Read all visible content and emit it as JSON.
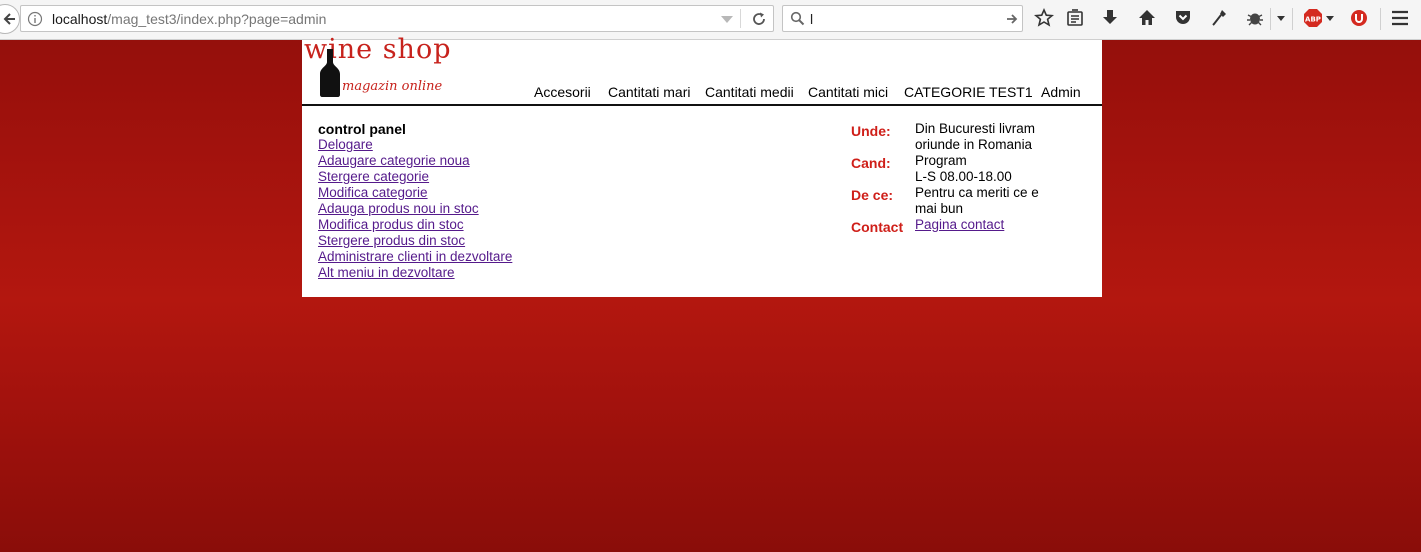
{
  "browser": {
    "url_host": "localhost",
    "url_path": "/mag_test3/index.php?page=admin",
    "search_value": "l"
  },
  "colors": {
    "accent_red": "#c7221c",
    "link_visited": "#551a8b",
    "page_bg": "#a3120d"
  },
  "logo": {
    "title": "wine shop",
    "subtitle": "magazin online"
  },
  "nav": {
    "items": [
      "Accesorii",
      "Cantitati mari",
      "Cantitati medii",
      "Cantitati mici",
      "CATEGORIE TEST1",
      "Admin"
    ]
  },
  "control_panel": {
    "title": "control panel",
    "links": [
      "Delogare",
      "Adaugare categorie noua",
      "Stergere categorie",
      "Modifica categorie",
      "Adauga produs nou in stoc",
      "Modifica produs din stoc",
      "Stergere produs din stoc",
      "Administrare clienti in dezvoltare",
      "Alt meniu in dezvoltare"
    ]
  },
  "info": {
    "where_label": "Unde:",
    "where_value": "Din Bucuresti livram oriunde in Romania",
    "when_label": "Cand:",
    "when_value_1": "Program",
    "when_value_2": "L-S 08.00-18.00",
    "why_label": "De ce:",
    "why_value": "Pentru ca meriti ce e mai bun",
    "contact_label": "Contact",
    "contact_link": "Pagina contact"
  }
}
